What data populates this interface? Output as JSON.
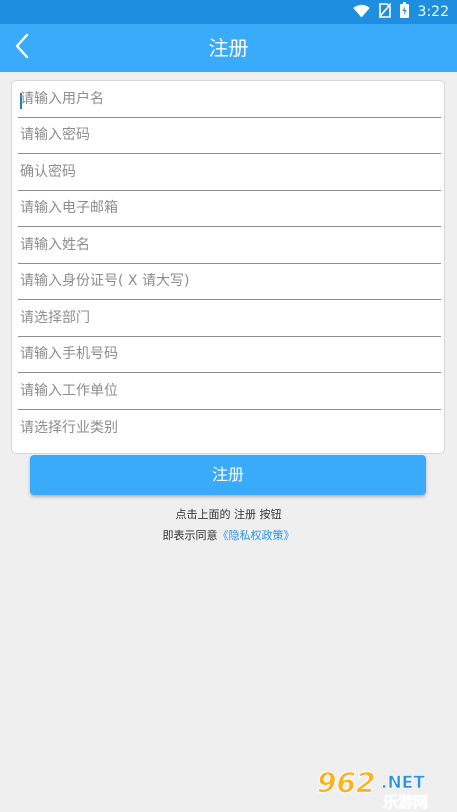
{
  "status_bar": {
    "time": "3:22",
    "icons": [
      "wifi-icon",
      "no-sim-icon",
      "battery-icon"
    ]
  },
  "header": {
    "title": "注册",
    "back_icon": "back-chevron-icon"
  },
  "form": {
    "fields": [
      {
        "placeholder": "请输入用户名"
      },
      {
        "placeholder": "请输入密码"
      },
      {
        "placeholder": "确认密码"
      },
      {
        "placeholder": "请输入电子邮箱"
      },
      {
        "placeholder": "请输入姓名"
      },
      {
        "placeholder": "请输入身份证号( X 请大写)"
      },
      {
        "placeholder": "请选择部门"
      },
      {
        "placeholder": "请输入手机号码"
      },
      {
        "placeholder": "请输入工作单位"
      },
      {
        "placeholder": "请选择行业类别"
      }
    ]
  },
  "register_button": {
    "label": "注册"
  },
  "hint": {
    "line1": "点击上面的 注册 按钮",
    "line2_prefix": "即表示同意",
    "privacy_link": "《隐私权政策》"
  },
  "watermark": {
    "number": "962",
    "domain": ".NET",
    "text": "乐游网"
  },
  "colors": {
    "status_bar": "#1e8fe0",
    "app_bar": "#3aabfa",
    "button": "#3aabfa",
    "link": "#2a93e6",
    "background": "#efefef"
  }
}
